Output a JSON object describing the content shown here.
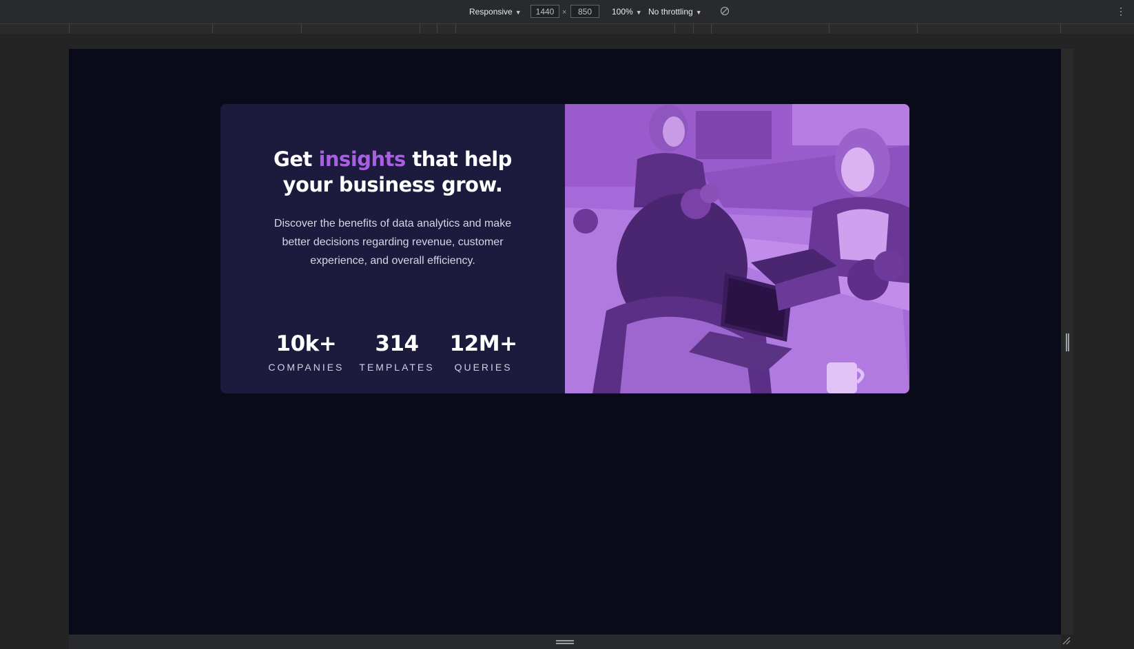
{
  "devtools": {
    "device_label": "Responsive",
    "width_value": "1440",
    "height_value": "850",
    "times": "×",
    "zoom_label": "100%",
    "throttle_label": "No throttling",
    "caret": "▼",
    "more_glyph": "⋮"
  },
  "card": {
    "headline_pre": "Get ",
    "headline_accent": "insights",
    "headline_post": " that help your business grow.",
    "description": "Discover the benefits of data analytics and make better decisions regarding revenue, customer experience, and overall efficiency.",
    "stats": [
      {
        "value": "10k+",
        "label": "COMPANIES"
      },
      {
        "value": "314",
        "label": "TEMPLATES"
      },
      {
        "value": "12M+",
        "label": "QUERIES"
      }
    ]
  },
  "colors": {
    "page_bg": "#090a1a",
    "card_bg": "#1c1a3d",
    "accent": "#a95fe3",
    "image_tint": "#a56ad9"
  },
  "icons": [
    "rotate-icon",
    "more-vert-icon",
    "drag-handle-icon",
    "resize-corner-icon"
  ]
}
